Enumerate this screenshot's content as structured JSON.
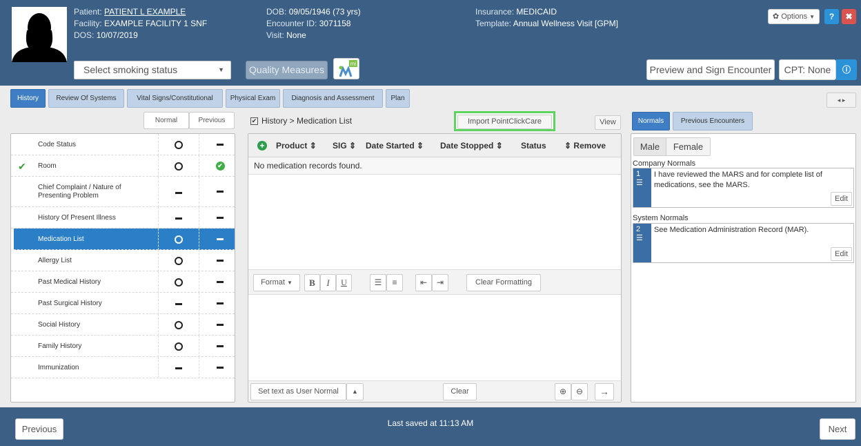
{
  "header": {
    "patient_label": "Patient:",
    "patient_name": "PATIENT L EXAMPLE",
    "facility_label": "Facility:",
    "facility": "EXAMPLE FACILITY 1 SNF",
    "dos_label": "DOS:",
    "dos": "10/07/2019",
    "dob_label": "DOB:",
    "dob": "09/05/1946 (73 yrs)",
    "encounter_label": "Encounter ID:",
    "encounter_id": "3071158",
    "visit_label": "Visit:",
    "visit": "None",
    "insurance_label": "Insurance:",
    "insurance": "MEDICAID",
    "template_label": "Template:",
    "template": "Annual Wellness Visit [GPM]",
    "smoking_placeholder": "Select smoking status",
    "quality_measures": "Quality Measures",
    "mi_badge": "mi",
    "options": "Options",
    "preview_sign": "Preview and Sign Encounter",
    "cpt": "CPT: None"
  },
  "tabs": [
    "History",
    "Review Of Systems",
    "Vital Signs/Constitutional",
    "Physical Exam",
    "Diagnosis and Assessment",
    "Plan"
  ],
  "history": {
    "col_normal": "Normal",
    "col_previous": "Previous",
    "rows": [
      {
        "label": "Code Status",
        "normal": "circle",
        "previous": "dash",
        "checked": false,
        "selected": false
      },
      {
        "label": "Room",
        "normal": "circle",
        "previous": "check",
        "checked": true,
        "selected": false
      },
      {
        "label": "Chief Complaint / Nature of Presenting Problem",
        "normal": "dash",
        "previous": "dash",
        "checked": false,
        "selected": false
      },
      {
        "label": "History Of Present Illness",
        "normal": "dash",
        "previous": "dash",
        "checked": false,
        "selected": false
      },
      {
        "label": "Medication List",
        "normal": "circle",
        "previous": "dash",
        "checked": false,
        "selected": true
      },
      {
        "label": "Allergy List",
        "normal": "circle",
        "previous": "dash",
        "checked": false,
        "selected": false
      },
      {
        "label": "Past Medical History",
        "normal": "circle",
        "previous": "dash",
        "checked": false,
        "selected": false
      },
      {
        "label": "Past Surgical History",
        "normal": "dash",
        "previous": "dash",
        "checked": false,
        "selected": false
      },
      {
        "label": "Social History",
        "normal": "circle",
        "previous": "dash",
        "checked": false,
        "selected": false
      },
      {
        "label": "Family History",
        "normal": "circle",
        "previous": "dash",
        "checked": false,
        "selected": false
      },
      {
        "label": "Immunization",
        "normal": "dash",
        "previous": "dash",
        "checked": false,
        "selected": false
      }
    ]
  },
  "middle": {
    "breadcrumb": "History > Medication List",
    "import_button": "Import PointClickCare",
    "view_button": "View",
    "columns": [
      "Product",
      "SIG",
      "Date Started",
      "Date Stopped",
      "Status",
      "Remove"
    ],
    "empty_message": "No medication records found.",
    "format_label": "Format",
    "clear_formatting": "Clear Formatting",
    "set_user_normal": "Set text as User Normal",
    "clear": "Clear"
  },
  "right": {
    "tab_normals": "Normals",
    "tab_previous": "Previous Encounters",
    "male": "Male",
    "female": "Female",
    "company_label": "Company Normals",
    "company_num": "1",
    "company_text": "I have reviewed the MARS and for complete list of medications, see the MARS.",
    "system_label": "System Normals",
    "system_num": "2",
    "system_text": "See Medication Administration Record (MAR).",
    "edit": "Edit"
  },
  "footer": {
    "previous": "Previous",
    "saved": "Last saved at 11:13 AM",
    "next": "Next"
  },
  "colors": {
    "header": "#3b5f85",
    "accent": "#2b7fc7",
    "import_highlight": "#5fd35f"
  }
}
